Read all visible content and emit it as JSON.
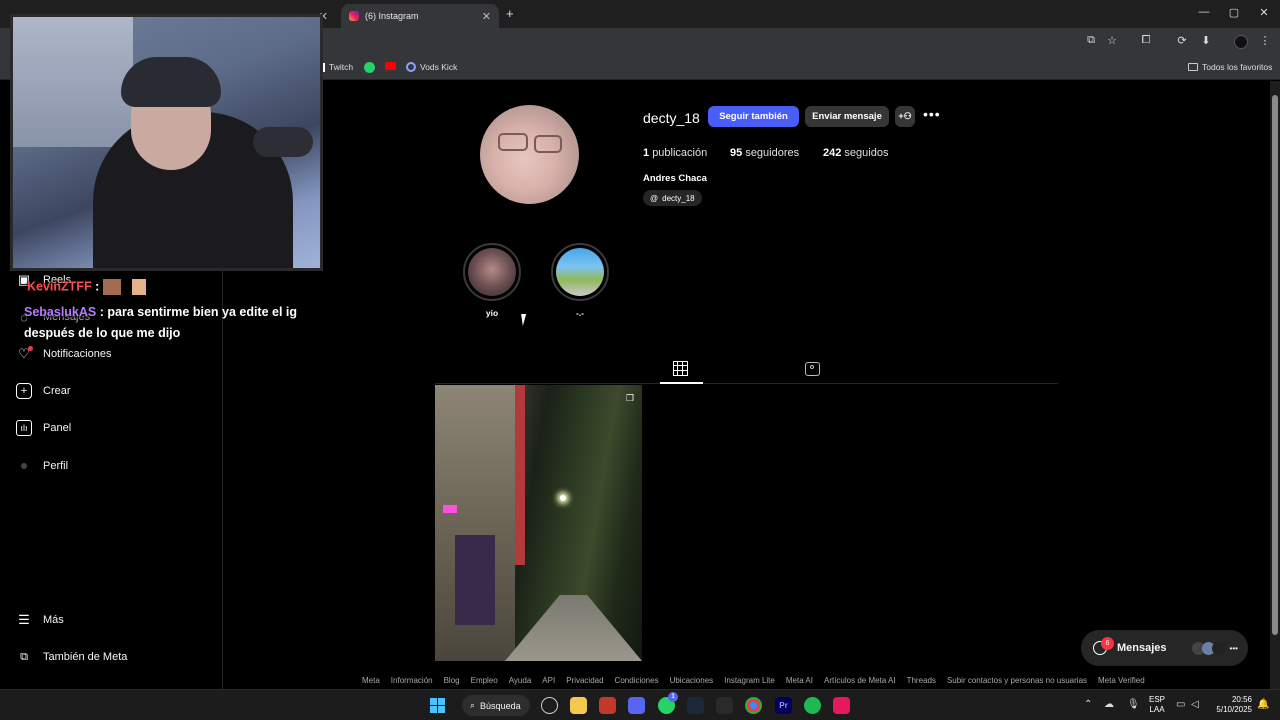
{
  "browser": {
    "tabs": [
      {
        "label": "",
        "active": false
      },
      {
        "label": "(6) Instagram",
        "active": true
      }
    ],
    "new_tab_label": "+",
    "window_controls": [
      "—",
      "▢",
      "✕"
    ],
    "bookmarks": [
      {
        "label": "Twitch"
      },
      {
        "label": ""
      },
      {
        "label": ""
      },
      {
        "label": "Vods Kick"
      }
    ],
    "all_bookmarks_label": "Todos los favoritos"
  },
  "sidebar": {
    "items": [
      {
        "label": "Reels",
        "icon": "reels-icon"
      },
      {
        "label": "Mensajes",
        "icon": "messenger-icon"
      },
      {
        "label": "Notificaciones",
        "icon": "heart-icon"
      },
      {
        "label": "Crear",
        "icon": "plus-square-icon"
      },
      {
        "label": "Panel",
        "icon": "chart-icon"
      },
      {
        "label": "Perfil",
        "icon": "avatar-icon"
      }
    ],
    "more_label": "Más",
    "meta_label": "También de Meta"
  },
  "profile": {
    "username": "decty_18",
    "follow_button": "Seguir también",
    "message_button": "Enviar mensaje",
    "posts_count": "1",
    "posts_label": "publicación",
    "followers_count": "95",
    "followers_label": "seguidores",
    "following_count": "242",
    "following_label": "seguidos",
    "full_name": "Andres Chaca",
    "threads_handle": "decty_18"
  },
  "highlights": [
    {
      "label": "yio"
    },
    {
      "label": "-.-"
    }
  ],
  "footer_links": [
    "Meta",
    "Información",
    "Blog",
    "Empleo",
    "Ayuda",
    "API",
    "Privacidad",
    "Condiciones",
    "Ubicaciones",
    "Instagram Lite",
    "Meta AI",
    "Artículos de Meta AI",
    "Threads",
    "Subir contactos y personas no usuarias",
    "Meta Verified"
  ],
  "messages_pill": {
    "label": "Mensajes",
    "badge": "6"
  },
  "overlay_chat": [
    {
      "user": "KevinZTFF",
      "text": " : "
    },
    {
      "user": "SebaslukAS",
      "text": " : para sentirme bien ya edite el ig",
      "text2": "después de lo que me dijo"
    }
  ],
  "taskbar": {
    "search_label": "Búsqueda",
    "lang": "ESP",
    "lang2": "LAA",
    "time": "20:56",
    "date": "5/10/2025",
    "discord_badge": "1"
  },
  "colors": {
    "accent": "#4a5df9",
    "instagram_bg": "#000000",
    "button_secondary": "#363636",
    "badge_red": "#ff3040",
    "chat_user_kevin": "#ff4d4d",
    "chat_user_seba": "#b57cff"
  }
}
